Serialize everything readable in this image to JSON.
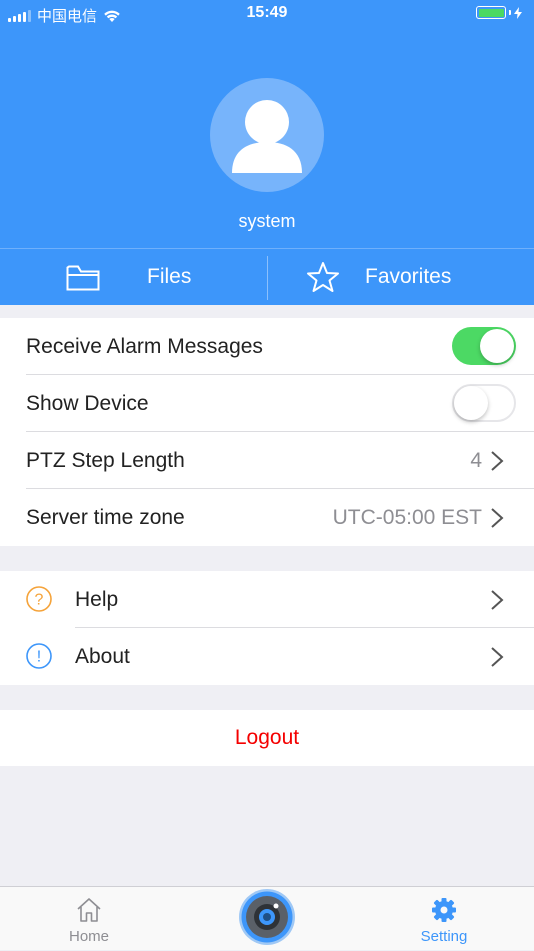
{
  "status_bar": {
    "carrier": "中国电信",
    "time": "15:49",
    "battery_color": "#4cd964"
  },
  "profile": {
    "username": "system",
    "avatar_icon": "user-avatar-icon"
  },
  "quick_tabs": [
    {
      "label": "Files",
      "icon": "folder-icon"
    },
    {
      "label": "Favorites",
      "icon": "star-icon"
    }
  ],
  "settings": {
    "receive_alarm": {
      "label": "Receive Alarm Messages",
      "enabled": true
    },
    "show_device": {
      "label": "Show Device",
      "enabled": false
    },
    "ptz_step": {
      "label": "PTZ Step Length",
      "value": "4"
    },
    "time_zone": {
      "label": "Server time zone",
      "value": "UTC-05:00 EST"
    }
  },
  "info": {
    "help": {
      "label": "Help",
      "icon": "question-circle-icon"
    },
    "about": {
      "label": "About",
      "icon": "info-circle-icon"
    }
  },
  "logout_label": "Logout",
  "tabbar": {
    "home_label": "Home",
    "setting_label": "Setting",
    "active": "Setting"
  },
  "colors": {
    "brand": "#3d96fa",
    "toggle_on": "#4cd964",
    "logout": "#f40000",
    "help_icon": "#f5a33a",
    "about_icon": "#3d96fa"
  }
}
